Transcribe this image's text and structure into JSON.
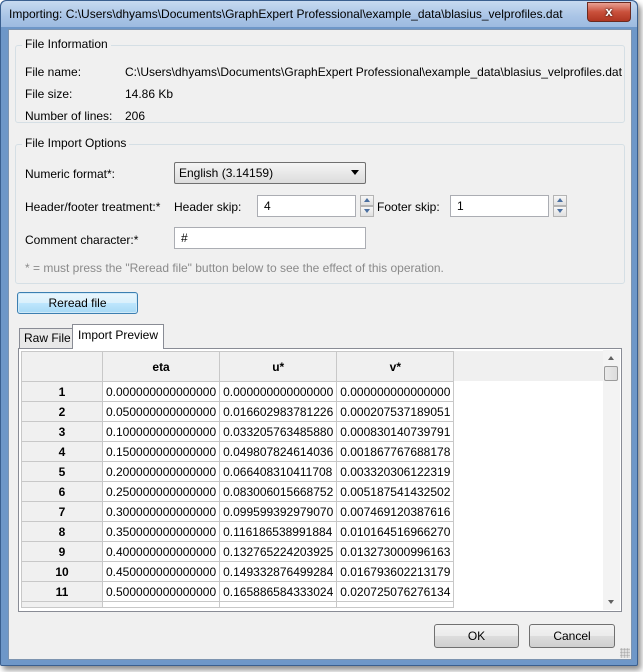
{
  "window": {
    "title": "Importing: C:\\Users\\dhyams\\Documents\\GraphExpert Professional\\example_data\\blasius_velprofiles.dat",
    "close_glyph": "x"
  },
  "file_info": {
    "group_title": "File Information",
    "name_label": "File name:",
    "name_value": "C:\\Users\\dhyams\\Documents\\GraphExpert Professional\\example_data\\blasius_velprofiles.dat",
    "size_label": "File size:",
    "size_value": "14.86 Kb",
    "lines_label": "Number of lines:",
    "lines_value": "206"
  },
  "import_options": {
    "group_title": "File Import Options",
    "numeric_format_label": "Numeric format*:",
    "numeric_format_value": "English (3.14159)",
    "header_footer_label": "Header/footer treatment:*",
    "header_skip_label": "Header skip:",
    "header_skip_value": "4",
    "footer_skip_label": "Footer skip:",
    "footer_skip_value": "1",
    "comment_label": "Comment character:*",
    "comment_value": "#",
    "note": "* = must press the \"Reread file\" button below to see the effect of this operation."
  },
  "reread_button": "Reread file",
  "tabs": [
    {
      "label": "Raw File",
      "active": false
    },
    {
      "label": "Import Preview",
      "active": true
    }
  ],
  "preview_table": {
    "columns": [
      "eta",
      "u*",
      "v*"
    ],
    "rows": [
      {
        "index": "1",
        "values": [
          "0.000000000000000",
          "0.000000000000000",
          "0.000000000000000"
        ]
      },
      {
        "index": "2",
        "values": [
          "0.050000000000000",
          "0.016602983781226",
          "0.000207537189051"
        ]
      },
      {
        "index": "3",
        "values": [
          "0.100000000000000",
          "0.033205763485880",
          "0.000830140739791"
        ]
      },
      {
        "index": "4",
        "values": [
          "0.150000000000000",
          "0.049807824614036",
          "0.001867767688178"
        ]
      },
      {
        "index": "5",
        "values": [
          "0.200000000000000",
          "0.066408310411708",
          "0.003320306122319"
        ]
      },
      {
        "index": "6",
        "values": [
          "0.250000000000000",
          "0.083006015668752",
          "0.005187541432502"
        ]
      },
      {
        "index": "7",
        "values": [
          "0.300000000000000",
          "0.099599392979070",
          "0.007469120387616"
        ]
      },
      {
        "index": "8",
        "values": [
          "0.350000000000000",
          "0.116186538991884",
          "0.010164516966270"
        ]
      },
      {
        "index": "9",
        "values": [
          "0.400000000000000",
          "0.132765224203925",
          "0.013273000996163"
        ]
      },
      {
        "index": "10",
        "values": [
          "0.450000000000000",
          "0.149332876499284",
          "0.016793602213179"
        ]
      },
      {
        "index": "11",
        "values": [
          "0.500000000000000",
          "0.165886584333024",
          "0.020725076276134"
        ]
      }
    ]
  },
  "footer": {
    "ok_label": "OK",
    "cancel_label": "Cancel"
  }
}
